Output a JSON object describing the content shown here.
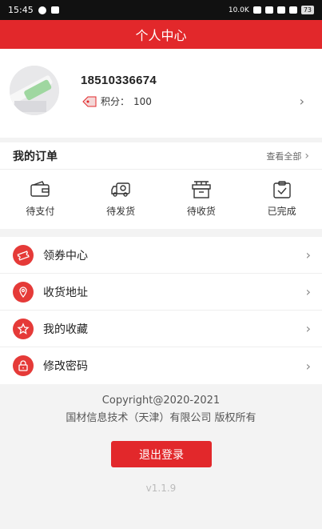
{
  "status_bar": {
    "time": "15:45",
    "notification_count": "1",
    "network_speed": "10.0K",
    "battery": "73"
  },
  "header": {
    "title": "个人中心"
  },
  "profile": {
    "phone": "18510336674",
    "points_label": "积分：",
    "points_value": "100",
    "arrow": "›"
  },
  "orders": {
    "title": "我的订单",
    "view_all": "查看全部",
    "chevron": "›",
    "items": [
      {
        "label": "待支付",
        "icon": "wallet-icon"
      },
      {
        "label": "待发货",
        "icon": "truck-icon"
      },
      {
        "label": "待收货",
        "icon": "package-icon"
      },
      {
        "label": "已完成",
        "icon": "clipboard-check-icon"
      }
    ]
  },
  "menu": {
    "items": [
      {
        "label": "领券中心",
        "icon": "ticket-icon"
      },
      {
        "label": "收货地址",
        "icon": "location-icon"
      },
      {
        "label": "我的收藏",
        "icon": "star-icon"
      },
      {
        "label": "修改密码",
        "icon": "lock-icon"
      }
    ],
    "arrow": "›"
  },
  "footer": {
    "copyright_line1": "Copyright@2020-2021",
    "copyright_line2": "国材信息技术（天津）有限公司 版权所有",
    "logout_label": "退出登录",
    "version": "v1.1.9"
  },
  "colors": {
    "brand_red": "#e2282b",
    "icon_red": "#e53a38"
  }
}
